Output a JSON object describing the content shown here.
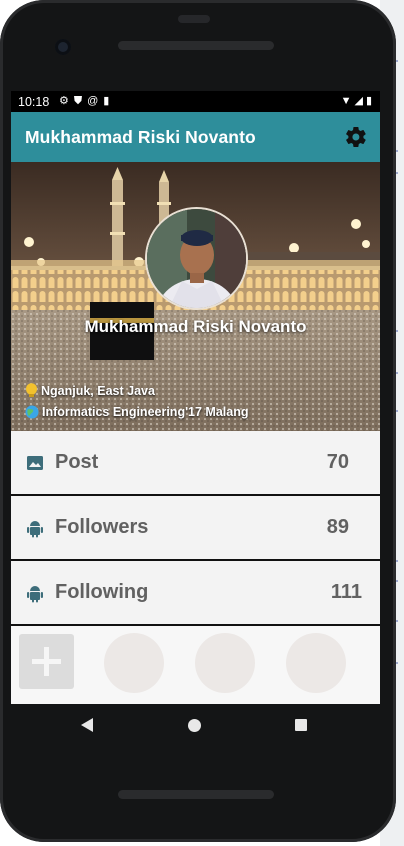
{
  "status_bar": {
    "time": "10:18",
    "left_icons": [
      "gear-icon",
      "shield-icon",
      "at-sign-icon",
      "sd-card-icon"
    ],
    "right_icons": [
      "wifi-icon",
      "signal-icon",
      "battery-icon"
    ]
  },
  "app_bar": {
    "title": "Mukhammad Riski Novanto",
    "settings_icon": "gear-icon",
    "color": "#2e8e9b"
  },
  "profile": {
    "name": "Mukhammad Riski Novanto",
    "location": "Nganjuk, East Java",
    "education": "Informatics Engineering'17 Malang",
    "location_icon": "lightbulb-icon",
    "education_icon": "globe-icon"
  },
  "stats": [
    {
      "label": "Post",
      "value": "70",
      "icon": "image-icon"
    },
    {
      "label": "Followers",
      "value": "89",
      "icon": "android-icon"
    },
    {
      "label": "Following",
      "value": "111",
      "icon": "android-icon"
    }
  ],
  "photos": {
    "add_icon": "plus-icon",
    "placeholder_count": 3
  },
  "nav": {
    "back_icon": "back-triangle-icon",
    "home_icon": "home-circle-icon",
    "recents_icon": "recents-square-icon"
  },
  "colors": {
    "accent": "#2e8e9b",
    "stat_text": "#616161",
    "icon_teal": "#3d6d7a"
  }
}
